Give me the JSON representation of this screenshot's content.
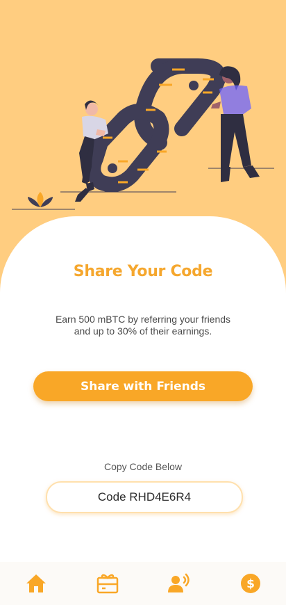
{
  "title": "Share Your Code",
  "description_line1": "Earn 500 mBTC by referring your friends",
  "description_line2": "and up to 30% of their earnings.",
  "share_button_label": "Share with Friends",
  "copy_label": "Copy Code Below",
  "code_text": "Code RHD4E6R4",
  "colors": {
    "background": "#ffcd80",
    "accent": "#f9a727",
    "dark": "#3f3d56"
  },
  "nav": [
    {
      "name": "home",
      "icon": "home-icon"
    },
    {
      "name": "rewards",
      "icon": "gift-card-icon"
    },
    {
      "name": "referral",
      "icon": "user-voice-icon"
    },
    {
      "name": "earnings",
      "icon": "dollar-coin-icon"
    }
  ]
}
